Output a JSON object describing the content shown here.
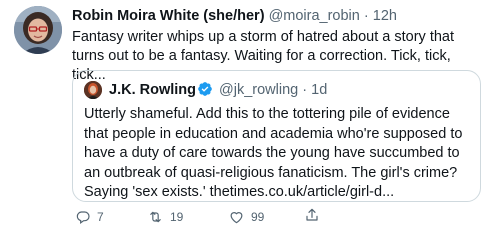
{
  "tweet": {
    "author_name": "Robin Moira White (she/her)",
    "author_handle": "@moira_robin",
    "separator": "·",
    "time": "12h",
    "text": "Fantasy writer whips up a storm of hatred about a story that turns out to be a fantasy.  Waiting for a correction. Tick, tick, tick...",
    "avatar_icon": "profile-photo",
    "quoted": {
      "author_name": "J.K. Rowling",
      "verified_icon": "verified-badge-icon",
      "verified_color": "#1d9bf0",
      "author_handle": "@jk_rowling",
      "separator": "·",
      "time": "1d",
      "text": "Utterly shameful. Add this to the tottering pile of evidence that people in education and academia who're supposed to have a duty of care towards the young have succumbed to an outbreak of quasi-religious fanaticism. The girl's crime? Saying 'sex exists.' thetimes.co.uk/article/girl-d..."
    },
    "actions": {
      "reply_count": "7",
      "retweet_count": "19",
      "like_count": "99",
      "share_label": ""
    }
  },
  "colors": {
    "text": "#0f1419",
    "muted": "#536471",
    "border": "#cfd9de",
    "accent": "#1d9bf0"
  }
}
